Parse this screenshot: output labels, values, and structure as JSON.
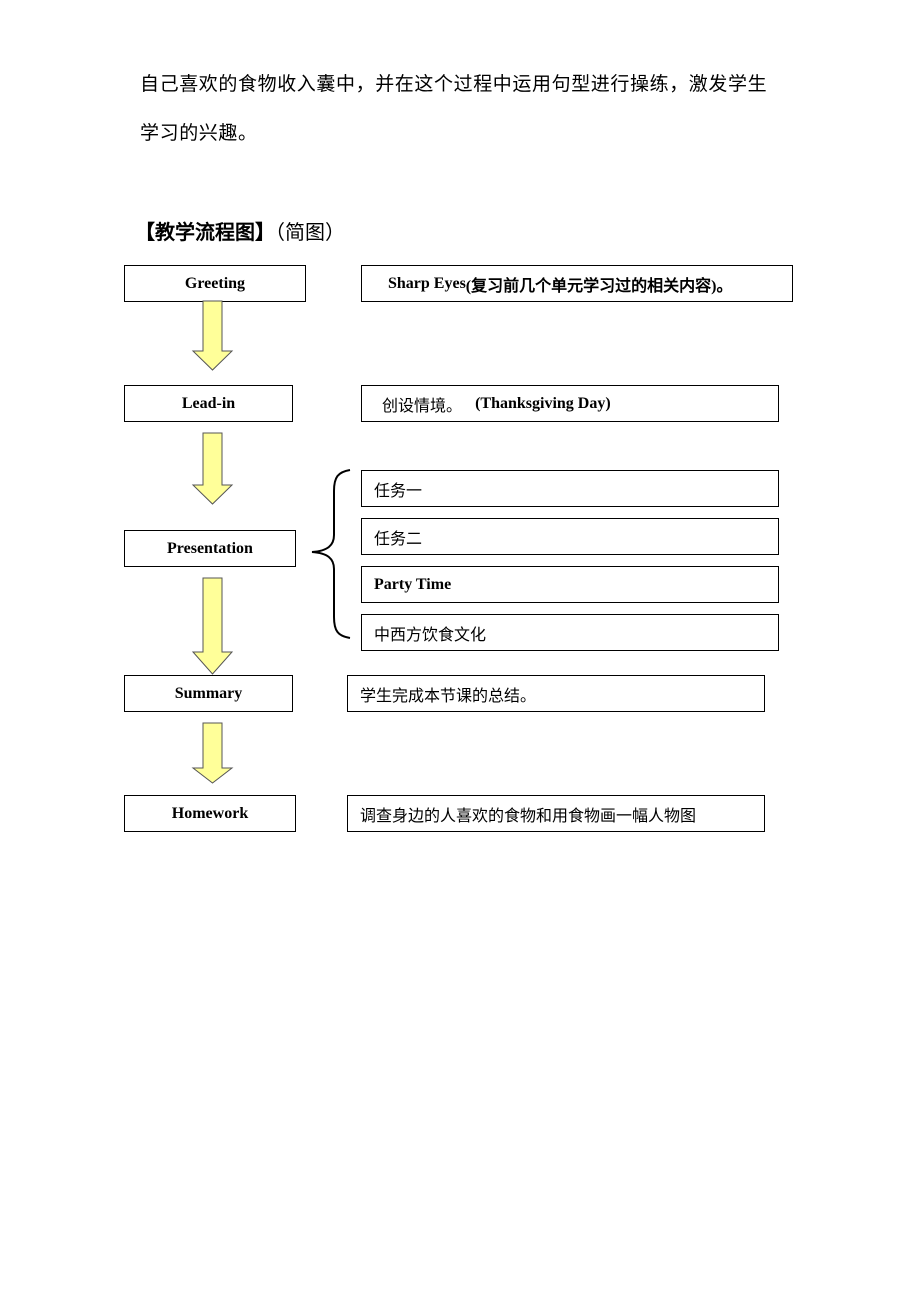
{
  "intro": {
    "line1": "自己喜欢的食物收入囊中，并在这个过程中运用句型进行操练，激发学生",
    "line2": "学习的兴趣。"
  },
  "section": {
    "title_bold": "【教学流程图】",
    "title_note": "（简图）"
  },
  "flow": {
    "arrow_color": "#ffff99",
    "steps": [
      {
        "label": "Greeting"
      },
      {
        "label": "Lead-in"
      },
      {
        "label": "Presentation"
      },
      {
        "label": "Summary"
      },
      {
        "label": "Homework"
      }
    ],
    "details": {
      "greeting": {
        "en": "Sharp Eyes",
        "zh": "(复习前几个单元学习过的相关内容)。"
      },
      "leadin": {
        "zh": "创设情境。 ",
        "en": "(Thanksgiving Day)"
      },
      "presentation": [
        {
          "text": "任务一"
        },
        {
          "text": "任务二"
        },
        {
          "text": "Party Time"
        },
        {
          "text": "中西方饮食文化"
        }
      ],
      "summary": {
        "text": "学生完成本节课的总结。"
      },
      "homework": {
        "text": "调查身边的人喜欢的食物和用食物画一幅人物图"
      }
    }
  }
}
